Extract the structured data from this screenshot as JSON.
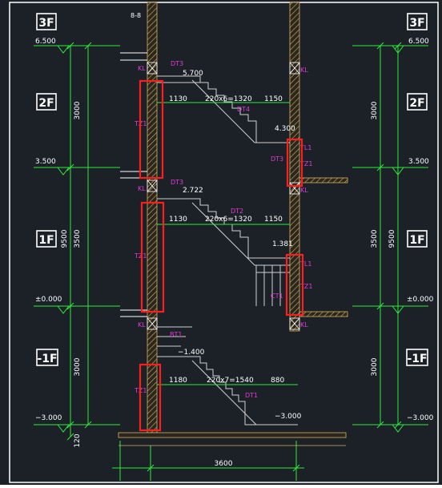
{
  "colors": {
    "background": "#1c2128",
    "frame": "#ffffff",
    "dimension_line": "#2eea3c",
    "text": "#ffffff",
    "magenta_label": "#e23ad6",
    "wall_hatch": "#d7b25a",
    "wall_fill": "#2a2620",
    "stair_line": "#cfcfcf",
    "highlight_box": "#ff1e1e",
    "floor_line": "#ffffff"
  },
  "floor_tags": {
    "f3_left": "3F",
    "f3_right": "3F",
    "f2_left": "2F",
    "f2_right": "2F",
    "f1_left": "1F",
    "f1_right": "1F",
    "b1_left": "-1F",
    "b1_right": "-1F"
  },
  "elevations": {
    "l_6500": "6.500",
    "r_6500": "6.500",
    "l_3500": "3.500",
    "r_3500": "3.500",
    "l_0": "±0.000",
    "r_0": "±0.000",
    "l_m3000": "−3.000",
    "r_m3000": "−3.000"
  },
  "vertical_dims": {
    "l_3000_top": "3000",
    "l_3500": "3500",
    "l_9500": "9500",
    "l_3000_bottom": "3000",
    "l_120": "120",
    "r_3000_top": "3000",
    "r_3500": "3500",
    "r_9500": "9500",
    "r_3000_bottom": "3000"
  },
  "horizontal_dims": {
    "bottom_3600": "3600"
  },
  "stair_labels": {
    "landing_5700": "5.700",
    "run2_left": "1130",
    "run2_mid": "220x6=1320",
    "run2_right": "1150",
    "landing_4300": "4.300",
    "landing_2722": "2.722",
    "run1_left": "1130",
    "run1_mid": "220x6=1320",
    "run1_right": "1150",
    "landing_1381": "1.381",
    "landing_m1400": "−1.400",
    "runb_left": "1180",
    "runb_mid": "220x7=1540",
    "runb_right": "880",
    "landing_m3000": "−3.000",
    "top_note": "8-8"
  },
  "member_labels": {
    "kl_1": "KL",
    "kl_2": "KL",
    "kl_3": "KL",
    "kl_4": "KL",
    "kl_5": "KL",
    "kl_6": "KL",
    "dt3_a": "DT3",
    "dt4": "DT4",
    "dt3_b": "DT3",
    "dt3_c": "DT3",
    "dt2": "DT2",
    "dt1": "DT1",
    "ct1": "CT1",
    "bt1": "BT1",
    "tz_2f": "TZ1",
    "tz_1f": "TZ1",
    "tz_b1": "TZ1",
    "tl1_upper": "TL1",
    "tz1_upper": "TZ1",
    "tl1_lower": "TL1",
    "tz1_lower": "TZ1"
  }
}
